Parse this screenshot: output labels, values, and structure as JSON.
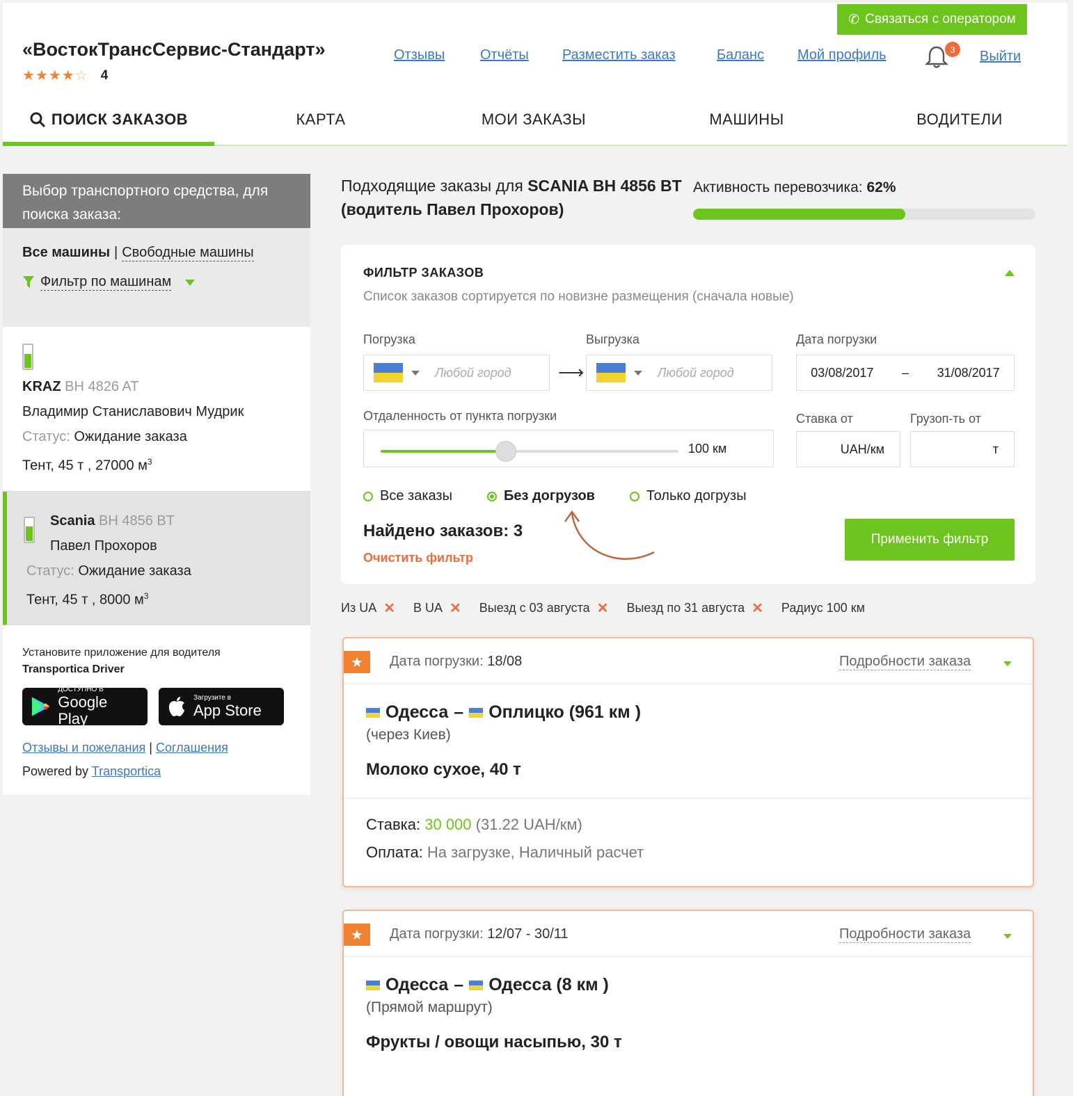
{
  "header": {
    "operator_button": "Связаться с оператором",
    "company_name": "«ВостокТрансСервис-Стандарт»",
    "rating_value": "4",
    "stars_filled": 4,
    "stars_total": 5,
    "links": [
      "Отзывы",
      "Отчёты",
      "Разместить заказ",
      "Баланс",
      "Мой профиль"
    ],
    "notifications_count": "3",
    "logout": "Выйти"
  },
  "nav": {
    "tabs": [
      "ПОИСК ЗАКАЗОВ",
      "КАРТА",
      "МОИ ЗАКАЗЫ",
      "МАШИНЫ",
      "ВОДИТЕЛИ"
    ],
    "active_index": 0
  },
  "sidebar": {
    "title": "Выбор транспортного средства, для поиска заказа:",
    "all_machines": "Все машины",
    "separator": "|",
    "free_machines": "Свободные машины",
    "filter_by_machines": "Фильтр по машинам",
    "vehicles": [
      {
        "brand": "KRAZ",
        "plate": "BH 4826 AT",
        "driver": "Владимир Станиславович Мудрик",
        "status_label": "Статус:",
        "status": "Ожидание заказа",
        "specs": "Тент, 45 т , 27000 м",
        "specs_sup": "3"
      },
      {
        "brand": "Scania",
        "plate": "BH 4856 BT",
        "driver": "Павел Прохоров",
        "status_label": "Статус:",
        "status": "Ожидание заказа",
        "specs": "Тент, 45 т , 8000 м",
        "specs_sup": "3"
      }
    ],
    "app_promo": "Установите приложение для водителя",
    "app_name": "Transportica Driver",
    "google_small": "ДОСТУПНО В",
    "google_big": "Google Play",
    "apple_small": "Загрузите в",
    "apple_big": "App Store",
    "feedback_link": "Отзывы и пожелания",
    "agreements_link": "Соглашения",
    "powered_by": "Powered by",
    "powered_link": "Transportica"
  },
  "main": {
    "title_prefix": "Подходящие заказы для",
    "title_vehicle": "SCANIA BH 4856 BT (водитель Павел Прохоров)",
    "activity_label": "Активность перевозчика:",
    "activity_value": "62%",
    "activity_fraction": 0.62
  },
  "filter": {
    "title": "ФИЛЬТР ЗАКАЗОВ",
    "subtitle": "Список заказов сортируется по новизне размещения (сначала новые)",
    "loading_label": "Погрузка",
    "unloading_label": "Выгрузка",
    "date_label": "Дата погрузки",
    "any_city": "Любой город",
    "date_from": "03/08/2017",
    "date_sep": "–",
    "date_to": "31/08/2017",
    "distance_label": "Отдаленность от пункта погрузки",
    "distance_value": "100 км",
    "slider_fraction": 0.42,
    "rate_label": "Ставка от",
    "rate_unit": "UAH/км",
    "capacity_label": "Грузоп-ть от",
    "capacity_unit": "т",
    "radio_options": [
      "Все заказы",
      "Без догрузов",
      "Только догрузы"
    ],
    "radio_selected": 1,
    "found_label": "Найдено заказов: 3",
    "clear": "Очистить фильтр",
    "apply": "Применить фильтр"
  },
  "chips": [
    {
      "label": "Из UA",
      "removable": true
    },
    {
      "label": "В UA",
      "removable": true
    },
    {
      "label": "Выезд с 03 августа",
      "removable": true
    },
    {
      "label": "Выезд по 31 августа",
      "removable": true
    },
    {
      "label": "Радиус 100 км",
      "removable": false
    }
  ],
  "orders": [
    {
      "date_label": "Дата погрузки:",
      "date": "18/08",
      "details": "Подробности заказа",
      "from": "Одесса",
      "dash": "–",
      "to": "Оплицко (961 км )",
      "via": "(через Киев)",
      "cargo": "Молоко сухое, 40 т",
      "rate_label": "Ставка:",
      "rate": "30 000",
      "rate_per_km": "(31.22 UAH/км)",
      "payment_label": "Оплата:",
      "payment": "На загрузке, Наличный расчет"
    },
    {
      "date_label": "Дата погрузки:",
      "date": "12/07 - 30/11",
      "details": "Подробности заказа",
      "from": "Одесса",
      "dash": "–",
      "to": "Одесса (8 км )",
      "via": "(Прямой маршрут)",
      "cargo": "Фрукты / овощи насыпью, 30 т"
    }
  ],
  "colors": {
    "accent_green": "#6cc41c",
    "accent_orange": "#f06a3c",
    "link_blue": "#3a78c8",
    "sidebar_header_gray": "#7d7d7d"
  }
}
